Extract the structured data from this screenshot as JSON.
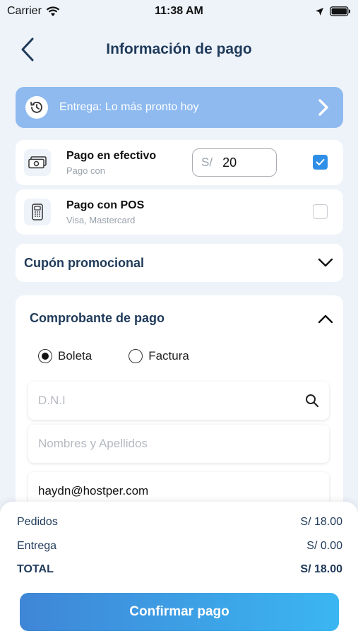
{
  "status_bar": {
    "carrier": "Carrier",
    "time": "11:38 AM"
  },
  "header": {
    "title": "Información de pago"
  },
  "delivery": {
    "text": "Entrega: Lo más pronto hoy"
  },
  "payment_methods": [
    {
      "title": "Pago en efectivo",
      "subtitle": "Pago con",
      "currency_prefix": "S/",
      "amount": "20",
      "checked": true
    },
    {
      "title": "Pago con POS",
      "subtitle": "Visa, Mastercard",
      "checked": false
    }
  ],
  "coupon": {
    "title": "Cupón promocional"
  },
  "receipt": {
    "title": "Comprobante de pago",
    "options": [
      {
        "label": "Boleta",
        "selected": true
      },
      {
        "label": "Factura",
        "selected": false
      }
    ],
    "dni_placeholder": "D.N.I",
    "name_placeholder": "Nombres y Apellidos",
    "email_value": "haydn@hostper.com"
  },
  "summary": {
    "orders_label": "Pedidos",
    "orders_value": "S/ 18.00",
    "delivery_label": "Entrega",
    "delivery_value": "S/ 0.00",
    "total_label": "TOTAL",
    "total_value": "S/ 18.00"
  },
  "confirm_button": {
    "label": "Confirmar pago"
  },
  "colors": {
    "accent": "#2f8fe6",
    "banner": "#8ebaf0",
    "title": "#1f3a5a"
  }
}
